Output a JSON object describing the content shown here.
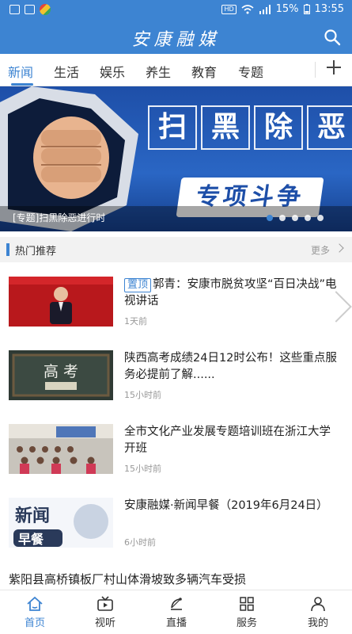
{
  "status_bar": {
    "battery": "15%",
    "time": "13:55",
    "hd": "HD"
  },
  "header": {
    "title": "安康融媒"
  },
  "tabs": [
    {
      "label": "新闻",
      "active": true
    },
    {
      "label": "生活"
    },
    {
      "label": "娱乐"
    },
    {
      "label": "养生"
    },
    {
      "label": "教育"
    },
    {
      "label": "专题"
    }
  ],
  "banner": {
    "headline": [
      "扫",
      "黑",
      "除",
      "恶"
    ],
    "subline": "专项斗争",
    "caption": "[专题]扫黑除恶进行时",
    "dots": 5,
    "active_dot": 0
  },
  "hot": {
    "title": "热门推荐",
    "more": "更多"
  },
  "news": [
    {
      "tag": "置顶",
      "title": "郭青：安康市脱贫攻坚“百日决战”电视讲话",
      "time": "1天前",
      "thumb": "speaker"
    },
    {
      "title": "陕西高考成绩24日12时公布！这些重点服务必提前了解......",
      "time": "15小时前",
      "thumb": "gaokao"
    },
    {
      "title": "全市文化产业发展专题培训班在浙江大学开班",
      "time": "15小时前",
      "thumb": "classroom"
    },
    {
      "title": "安康融媒·新闻早餐（2019年6月24日）",
      "time": "6小时前",
      "thumb": "breakfast"
    }
  ],
  "plain_news": "紫阳县高桥镇板厂村山体滑坡致多辆汽车受损",
  "bottom_nav": [
    {
      "label": "首页",
      "icon": "home-icon",
      "active": true
    },
    {
      "label": "视听",
      "icon": "tv-icon"
    },
    {
      "label": "直播",
      "icon": "broadcast-icon"
    },
    {
      "label": "服务",
      "icon": "grid-icon"
    },
    {
      "label": "我的",
      "icon": "user-icon"
    }
  ],
  "colors": {
    "brand": "#3d84d2",
    "banner": "#1e4fa8"
  }
}
